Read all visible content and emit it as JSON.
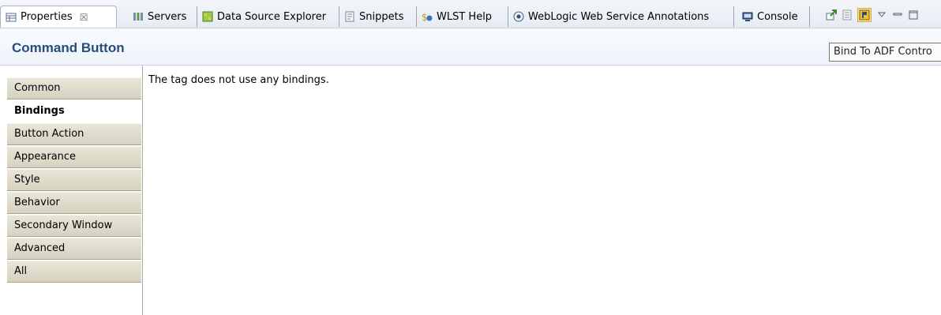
{
  "tabs": [
    {
      "label": "Properties",
      "close": "☒",
      "active": true
    },
    {
      "label": "Servers",
      "active": false
    },
    {
      "label": "Data Source Explorer",
      "active": false
    },
    {
      "label": "Snippets",
      "active": false
    },
    {
      "label": "WLST Help",
      "active": false
    },
    {
      "label": "WebLogic Web Service Annotations",
      "active": false
    },
    {
      "label": "Console",
      "active": false
    }
  ],
  "toolbar": {
    "icons": [
      "new-property-icon",
      "show-description-icon",
      "bind-to-adf-control-icon",
      "view-menu-icon",
      "minimize-icon",
      "maximize-icon"
    ]
  },
  "header": {
    "title": "Command Button",
    "tooltip": "Bind To ADF Contro"
  },
  "categories": [
    {
      "label": "Common",
      "selected": false
    },
    {
      "label": "Bindings",
      "selected": true
    },
    {
      "label": "Button Action",
      "selected": false
    },
    {
      "label": "Appearance",
      "selected": false
    },
    {
      "label": "Style",
      "selected": false
    },
    {
      "label": "Behavior",
      "selected": false
    },
    {
      "label": "Secondary Window",
      "selected": false
    },
    {
      "label": "Advanced",
      "selected": false
    },
    {
      "label": "All",
      "selected": false
    }
  ],
  "content": {
    "message": "The tag does not use any bindings."
  },
  "colors": {
    "title": "#294c7b",
    "category_bg": "#dcd8c6",
    "tooltip_bg": "#fbfbfb"
  }
}
